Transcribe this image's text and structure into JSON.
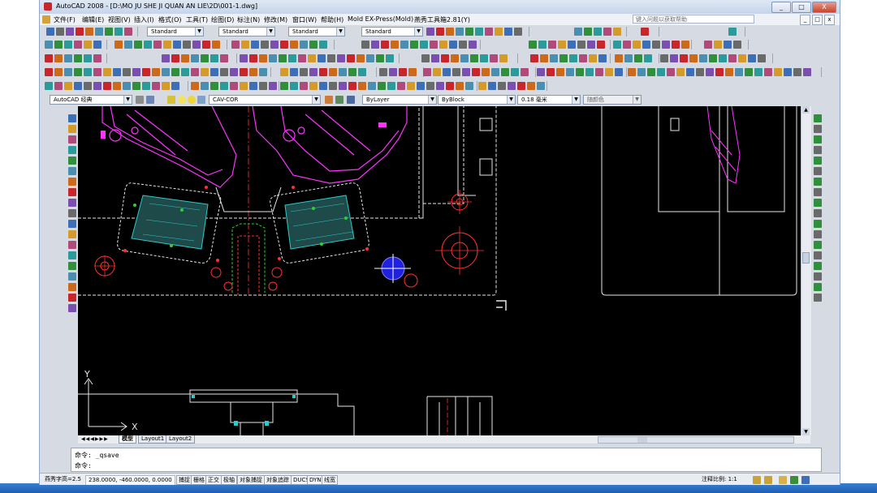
{
  "window": {
    "title": "AutoCAD 2008 - [D:\\MO JU SHE JI QUAN AN LIE\\2D\\001-1.dwg]",
    "btn_min": "_",
    "btn_max": "□",
    "btn_close": "X"
  },
  "menu": {
    "items": [
      "文件(F)",
      "编辑(E)",
      "视图(V)",
      "插入(I)",
      "格式(O)",
      "工具(T)",
      "绘图(D)",
      "标注(N)",
      "修改(M)",
      "窗口(W)",
      "帮助(H)",
      "Mold EX-Press(Mold)",
      "燕秀工具箱2.81(Y)"
    ],
    "help_placeholder": "键入问题以获取帮助",
    "mdi_min": "_",
    "mdi_max": "□",
    "mdi_close": "x"
  },
  "toolbar": {
    "style_combos": [
      "Standard",
      "Standard",
      "Standard",
      "Standard"
    ],
    "workspace": "AutoCAD 经典",
    "layer": "CAV-COR",
    "color": "ByLayer",
    "linetype": "ByBlock",
    "lineweight": "0.18 毫米",
    "plotstyle": "随颜色"
  },
  "drawing": {
    "ucs_y": "Y",
    "ucs_x": "X"
  },
  "layout_tabs": [
    "模型",
    "Layout1",
    "Layout2"
  ],
  "command": {
    "line1": "命令: _qsave",
    "line2": "命令:"
  },
  "status": {
    "text_height": "燕秀字高=2.5",
    "coords": "238.0000, -460.0000, 0.0000",
    "toggles": [
      "捕捉",
      "栅格",
      "正交",
      "极轴",
      "对象捕捉",
      "对象追踪",
      "DUCS",
      "DYN",
      "线宽"
    ],
    "annotation_scale": "注释比例: 1:1"
  },
  "colors": {
    "title_bar": "#c5d5ea",
    "canvas": "#000000",
    "magenta": "#ff33ff",
    "white_line": "#e6e6e6",
    "red_center": "#ff3030",
    "cyan": "#30c8c8",
    "blue_fill": "#2020e0"
  }
}
